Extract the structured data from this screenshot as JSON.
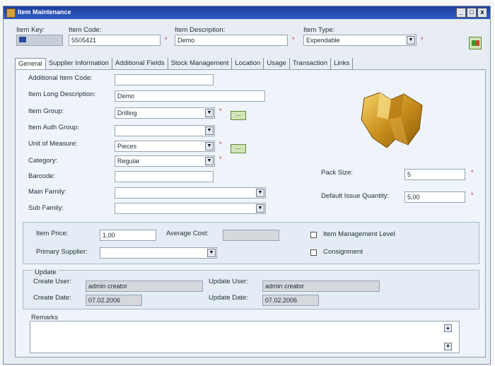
{
  "window": {
    "title": "Item Maintenance",
    "buttons": [
      "_",
      "□",
      "x"
    ]
  },
  "header": {
    "item_key_label": "Item Key:",
    "item_code_label": "Item Code:",
    "item_code_value": "5505421",
    "item_description_label": "Item Description:",
    "item_description_value": "Demo",
    "item_type_label": "Item Type:",
    "item_type_value": "Expendable"
  },
  "tabs": [
    {
      "label": "General"
    },
    {
      "label": "Supplier Information"
    },
    {
      "label": "Additional Fields"
    },
    {
      "label": "Stock Management"
    },
    {
      "label": "Location"
    },
    {
      "label": "Usage"
    },
    {
      "label": "Transaction"
    },
    {
      "label": "Links"
    }
  ],
  "general": {
    "additional_item_code_label": "Additional Item Code:",
    "additional_item_code_value": "",
    "item_long_description_label": "Item Long Description:",
    "item_long_description_value": "Demo",
    "item_group_label": "Item Group:",
    "item_group_value": "Drilling",
    "item_auth_group_label": "Item Auth Group:",
    "item_auth_group_value": "",
    "unit_of_measure_label": "Unit of Measure:",
    "unit_of_measure_value": "Pieces",
    "category_label": "Category:",
    "category_value": "Regular",
    "barcode_label": "Barcode:",
    "barcode_value": "",
    "main_family_label": "Main Family:",
    "main_family_value": "",
    "sub_family_label": "Sub Family:",
    "sub_family_value": "",
    "pack_size_label": "Pack Size:",
    "pack_size_value": "5",
    "default_issue_qty_label": "Default Issue Quantity:",
    "default_issue_qty_value": "5,00",
    "dots": "..."
  },
  "pricing": {
    "item_price_label": "Item Price:",
    "item_price_value": "1,00",
    "average_cost_label": "Average Cost:",
    "average_cost_value": "",
    "primary_supplier_label": "Primary Supplier:",
    "primary_supplier_value": "",
    "item_management_level_label": "Item Management Level",
    "consignment_label": "Consignment"
  },
  "update": {
    "group_label": "Update",
    "create_user_label": "Create User:",
    "create_user_value": "admin creator",
    "update_user_label": "Update User:",
    "update_user_value": "admin creator",
    "create_date_label": "Create Date:",
    "create_date_value": "07.02.2006",
    "update_date_label": "Update Date:",
    "update_date_value": "07.02.2006"
  },
  "remarks": {
    "label": "Remarks",
    "value": ""
  },
  "colors": {
    "titlebar": "#2f5dc7",
    "panel": "#eef4f9",
    "required": "#b33333"
  },
  "icons": {
    "product_image": "drill-insert-image",
    "save": "save-icon",
    "dots": "browse-button"
  }
}
